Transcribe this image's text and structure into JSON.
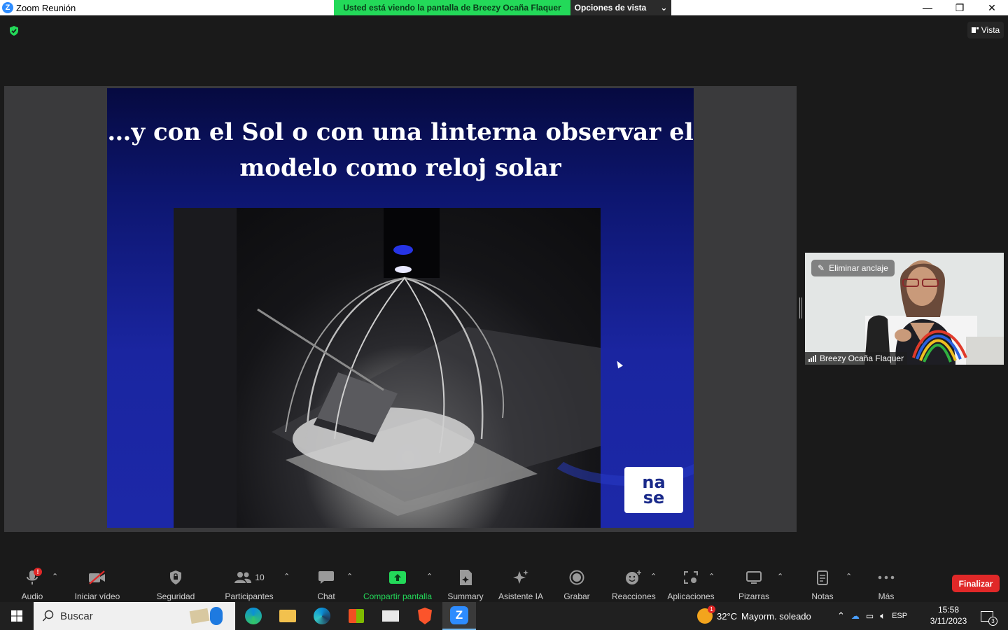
{
  "window": {
    "title": "Zoom Reunión",
    "controls": {
      "minimize": "—",
      "restore": "❐",
      "close": "✕"
    }
  },
  "share_banner": {
    "text": "Usted está viendo la pantalla de Breezy Ocaña Flaquer",
    "options_label": "Opciones de vista",
    "options_caret": "⌄"
  },
  "view_button": {
    "label": "Vista"
  },
  "slide": {
    "title_line1": "…y con el Sol o con una linterna observar el",
    "title_line2": "modelo como reloj solar",
    "logo_top": "na",
    "logo_bottom": "se"
  },
  "participant_tile": {
    "unpin_label": "Eliminar anclaje",
    "name": "Breezy Ocaña Flaquer"
  },
  "toolbar": {
    "audio": "Audio",
    "audio_badge": "!",
    "video": "Iniciar vídeo",
    "security": "Seguridad",
    "participants": "Participantes",
    "participants_count": "10",
    "chat": "Chat",
    "share": "Compartir pantalla",
    "summary": "Summary",
    "ai": "Asistente IA",
    "record": "Grabar",
    "reactions": "Reacciones",
    "apps": "Aplicaciones",
    "whiteboards": "Pizarras",
    "notes": "Notas",
    "more": "Más",
    "end": "Finalizar",
    "caret": "⌃"
  },
  "taskbar": {
    "search_placeholder": "Buscar",
    "weather_temp": "32°C",
    "weather_text": "Mayorm. soleado",
    "weather_badge": "1",
    "language": "ESP",
    "time": "15:58",
    "date": "3/11/2023",
    "notifications_count": "3"
  },
  "colors": {
    "accent_green": "#23d959",
    "end_red": "#e02828",
    "zoom_blue": "#2d8cff"
  }
}
